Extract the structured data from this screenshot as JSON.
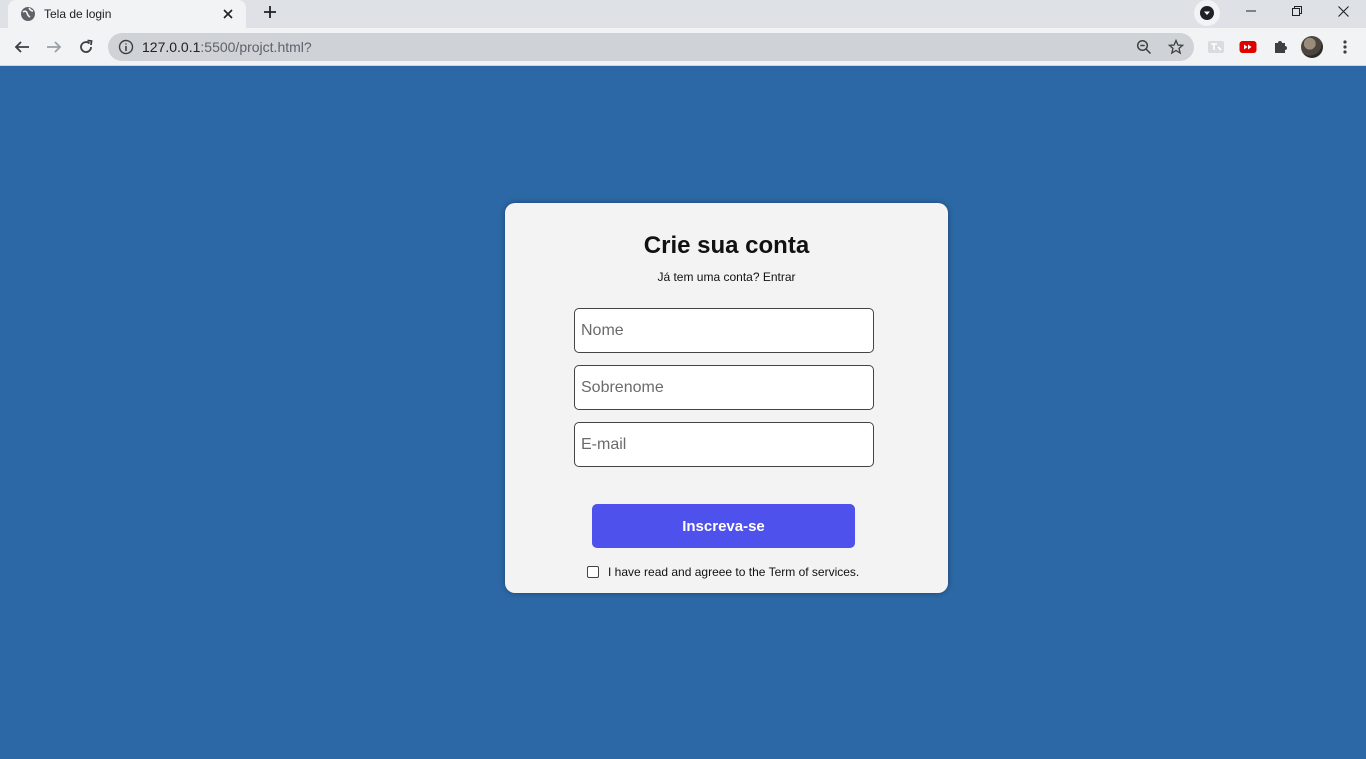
{
  "browser": {
    "tab": {
      "title": "Tela de login",
      "favicon": "globe-icon",
      "close_icon": "close-icon"
    },
    "new_tab_icon": "plus-icon",
    "tab_search_icon": "chevron-down-icon",
    "window_controls": [
      "minimize-icon",
      "restore-icon",
      "close-icon"
    ],
    "nav": {
      "back_icon": "back-arrow-icon",
      "forward_icon": "forward-arrow-icon",
      "reload_icon": "reload-icon"
    },
    "address_bar": {
      "info_icon": "info-icon",
      "url_host": "127.0.0.1",
      "url_rest": ":5500/projct.html?",
      "zoom_icon": "zoom-icon",
      "bookmark_icon": "star-icon"
    },
    "extensions": [
      "translate-icon",
      "youtube-icon",
      "puzzle-icon"
    ],
    "profile_icon": "avatar",
    "menu_icon": "kebab-menu-icon"
  },
  "page": {
    "background": "#2c68a6",
    "title": "Crie sua conta",
    "subtitle": "Já tem uma conta? Entrar",
    "fields": [
      {
        "placeholder": "Nome",
        "value": ""
      },
      {
        "placeholder": "Sobrenome",
        "value": ""
      },
      {
        "placeholder": "E-mail",
        "value": ""
      }
    ],
    "submit_label": "Inscreva-se",
    "submit_color": "#4f51ec",
    "terms_checked": false,
    "terms_text": "I have read and agreee to the Term of services."
  }
}
